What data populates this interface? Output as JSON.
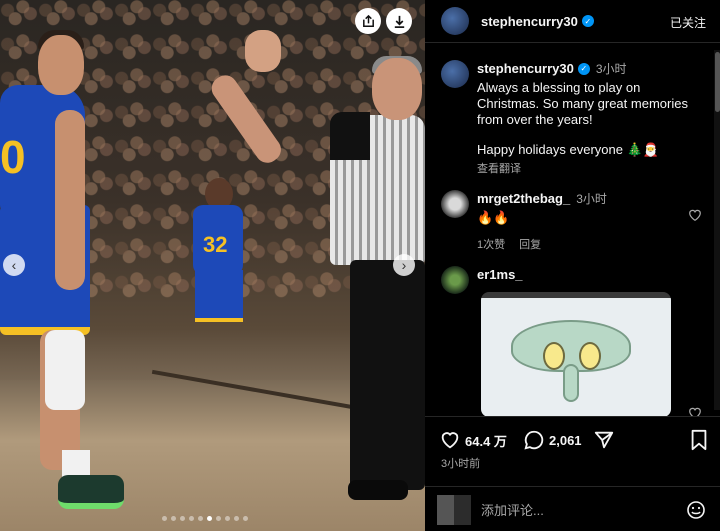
{
  "photo": {
    "player_number_main": "0",
    "player_number_back": "32",
    "nav_prev_icon": "chevron-left-icon",
    "nav_next_icon": "chevron-right-icon",
    "save_icon": "share-icon",
    "download_icon": "download-icon",
    "carousel_dots": 10,
    "carousel_active_index": 5
  },
  "header": {
    "username": "stephencurry30",
    "follow_label": "已关注"
  },
  "post": {
    "username": "stephencurry30",
    "time": "3小时",
    "caption": "Always a blessing to play on Christmas. So many great memories from over the years!",
    "caption2": "Happy holidays everyone 🎄🎅",
    "translate": "查看翻译"
  },
  "comments": [
    {
      "username": "mrget2thebag_",
      "time": "3小时",
      "text": "🔥🔥",
      "likes_label": "1次赞",
      "reply_label": "回复"
    },
    {
      "username": "er1ms_"
    }
  ],
  "actions": {
    "likes": "64.4 万",
    "comments": "2,061",
    "posted": "3小时前"
  },
  "composer": {
    "placeholder": "添加评论..."
  },
  "colors": {
    "verified": "#0095f6",
    "background": "#000000",
    "muted": "#a8a8a8"
  }
}
